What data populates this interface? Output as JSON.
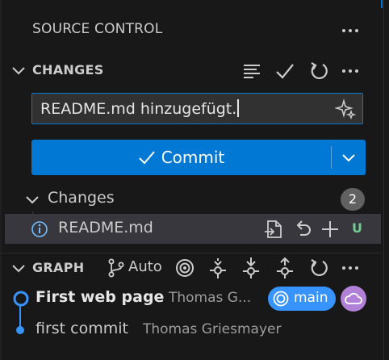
{
  "panel": {
    "title": "SOURCE CONTROL",
    "colors": {
      "accent": "#0078d4",
      "graph_blue": "#3794ff",
      "untracked_green": "#73c991",
      "remote_purple": "#b180d7"
    }
  },
  "changes_section": {
    "label": "CHANGES",
    "commit_message": "README.md hinzugefügt.",
    "commit_button_label": "Commit",
    "group": {
      "label": "Changes",
      "count": "2",
      "files": [
        {
          "name": "README.md",
          "status": "U",
          "icon": "info-icon"
        }
      ]
    }
  },
  "graph_section": {
    "label": "GRAPH",
    "auto_label": "Auto",
    "commits": [
      {
        "message": "First web page",
        "author": "Thomas G...",
        "branch": "main",
        "remote_icon": "cloud-icon"
      },
      {
        "message": "first commit",
        "author": "Thomas Griesmayer"
      }
    ]
  }
}
